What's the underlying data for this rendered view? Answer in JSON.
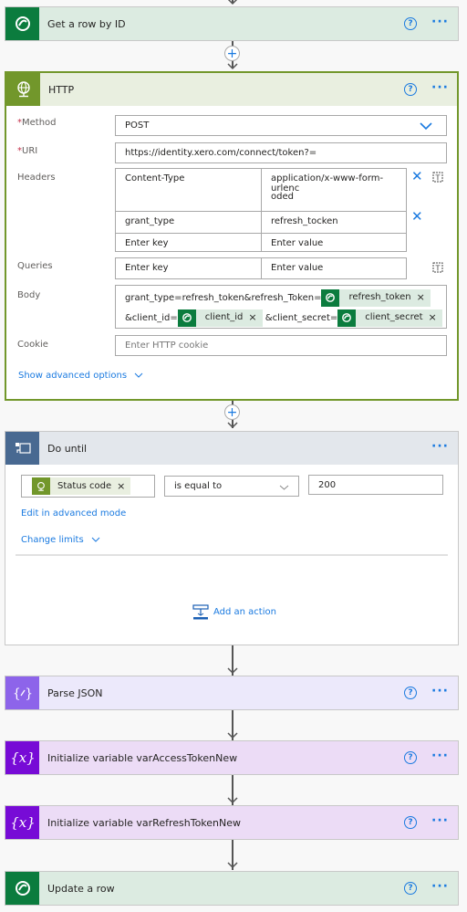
{
  "steps": {
    "get_row": {
      "title": "Get a row by ID",
      "icon": "dataverse-icon"
    },
    "http": {
      "title": "HTTP",
      "icon": "globe-icon",
      "method": {
        "label": "Method",
        "required": "*",
        "value": "POST"
      },
      "uri": {
        "label": "URI",
        "required": "*",
        "value": "https://identity.xero.com/connect/token?="
      },
      "headers": {
        "label": "Headers",
        "rows": [
          {
            "key": "Content-Type",
            "value_line1": "application/x-www-form-urlenc",
            "value_line2": "oded"
          },
          {
            "key": "grant_type",
            "value": "refresh_tocken"
          }
        ],
        "key_placeholder": "Enter key",
        "value_placeholder": "Enter value"
      },
      "queries": {
        "label": "Queries",
        "key_placeholder": "Enter key",
        "value_placeholder": "Enter value"
      },
      "body": {
        "label": "Body",
        "text1": "grant_type=refresh_token&refresh_Token=",
        "token1": "refresh_token",
        "text2": "&client_id=",
        "token2": "client_id",
        "text3": "&client_secret=",
        "token3": "client_secret"
      },
      "cookie": {
        "label": "Cookie",
        "placeholder": "Enter HTTP cookie"
      },
      "advanced_link": "Show advanced options"
    },
    "do_until": {
      "title": "Do until",
      "icon": "loop-icon",
      "condition": {
        "left_token": "Status code",
        "operator": "is equal to",
        "right_value": "200"
      },
      "edit_advanced": "Edit in advanced mode",
      "change_limits": "Change limits",
      "add_action": "Add an action"
    },
    "parse_json": {
      "title": "Parse JSON",
      "icon": "parse-json-icon"
    },
    "init_var_access": {
      "title": "Initialize variable varAccessTokenNew",
      "icon": "variable-icon"
    },
    "init_var_refresh": {
      "title": "Initialize variable varRefreshTokenNew",
      "icon": "variable-icon"
    },
    "update_row": {
      "title": "Update a row",
      "icon": "dataverse-icon"
    }
  },
  "glyphs": {
    "help": "?",
    "more": "···",
    "close": "×",
    "remove": "✕",
    "plus": "+"
  },
  "colors": {
    "accent": "#1a7ae0",
    "dataverse": "#0b7c3e",
    "http": "#72972b",
    "do_until": "#486991",
    "parse_json": "#8d64ea",
    "variable": "#770bd6"
  }
}
